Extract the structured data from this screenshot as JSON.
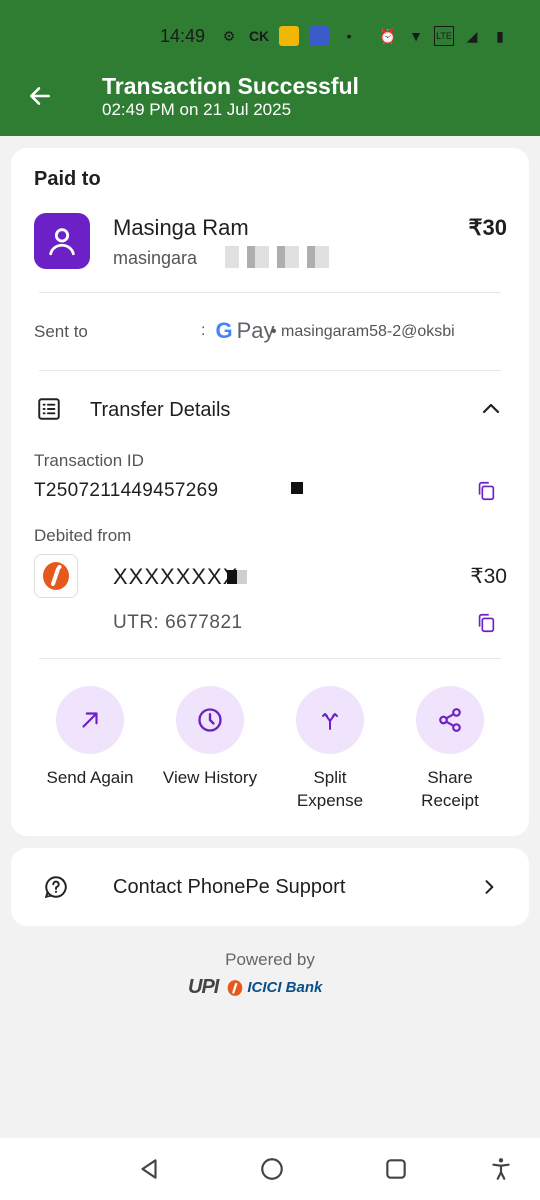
{
  "status_bar": {
    "time": "14:49",
    "ck": "CK"
  },
  "header": {
    "title": "Transaction Successful",
    "subtitle": "02:49 PM on 21 Jul 2025",
    "bg_color": "#2e7d32"
  },
  "paid_to": {
    "heading": "Paid to",
    "name": "Masinga Ram",
    "vpa_prefix": "masingara",
    "amount": "₹30"
  },
  "sent_to": {
    "label": "Sent to",
    "app_g": "G",
    "app_pay": "Pay",
    "vpa": "• masingaram58-2@oksbi"
  },
  "transfer_details": {
    "label": "Transfer Details",
    "transaction_id_label": "Transaction ID",
    "transaction_id": "T2507211449457269",
    "debited_from_label": "Debited from",
    "account": "XXXXXXXX",
    "amount": "₹30",
    "utr": "UTR: 6677821"
  },
  "actions": [
    {
      "label": "Send Again",
      "icon": "arrow-up-right-icon"
    },
    {
      "label": "View History",
      "icon": "clock-icon"
    },
    {
      "label": "Split Expense",
      "icon": "split-icon"
    },
    {
      "label": "Share Receipt",
      "icon": "share-icon"
    }
  ],
  "support": {
    "label": "Contact PhonePe Support"
  },
  "footer": {
    "powered_by": "Powered by",
    "upi": "UPI",
    "bank": "ICICI Bank"
  },
  "colors": {
    "accent_purple": "#6b21c6",
    "action_bg": "#efe4fb"
  }
}
